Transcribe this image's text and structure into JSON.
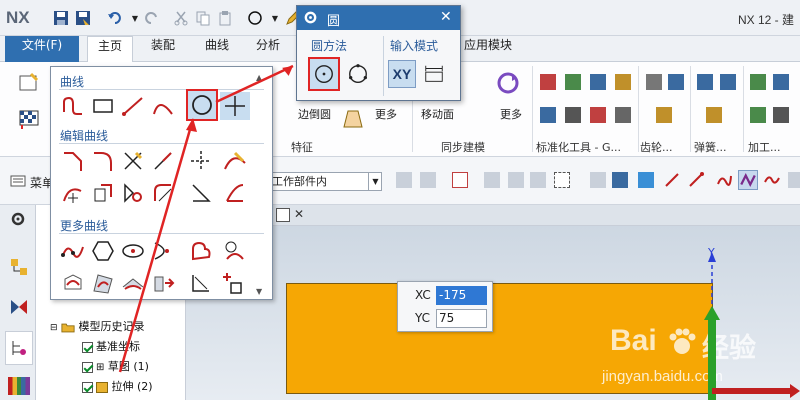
{
  "app": {
    "logo": "NX",
    "title": "NX 12 - 建"
  },
  "tabs": [
    "文件(F)",
    "主页",
    "装配",
    "曲线",
    "分析",
    "应用模块"
  ],
  "ribbon": {
    "groups": [
      "特征",
      "同步建模",
      "标准化工具 - G...",
      "齿轮...",
      "弹簧...",
      "加工..."
    ],
    "labels": {
      "edge_blend": "边倒圆",
      "more1": "更多",
      "move_face": "移动面",
      "more2": "更多"
    }
  },
  "toolbar2": {
    "menu_label": "菜单",
    "scope_value": "工作部件内"
  },
  "navigator": {
    "items": [
      "模型历史记录",
      "基准坐标",
      "草图 (1)",
      "拉伸 (2)"
    ]
  },
  "gallery": {
    "sections": [
      "曲线",
      "编辑曲线",
      "更多曲线"
    ]
  },
  "dialog": {
    "title": "圆",
    "group1": "圆方法",
    "group2": "输入模式",
    "xy_label": "XY"
  },
  "coords": {
    "xc_label": "XC",
    "xc_value": "-175",
    "yc_label": "YC",
    "yc_value": "75"
  },
  "axis": {
    "y_label": "Y"
  },
  "watermark": {
    "brand": "Bai",
    "brand2": "经验",
    "url": "jingyan.baidu.com"
  },
  "colors": {
    "accent": "#2f6fb0",
    "part": "#f6a704",
    "annotation": "#e02424"
  }
}
